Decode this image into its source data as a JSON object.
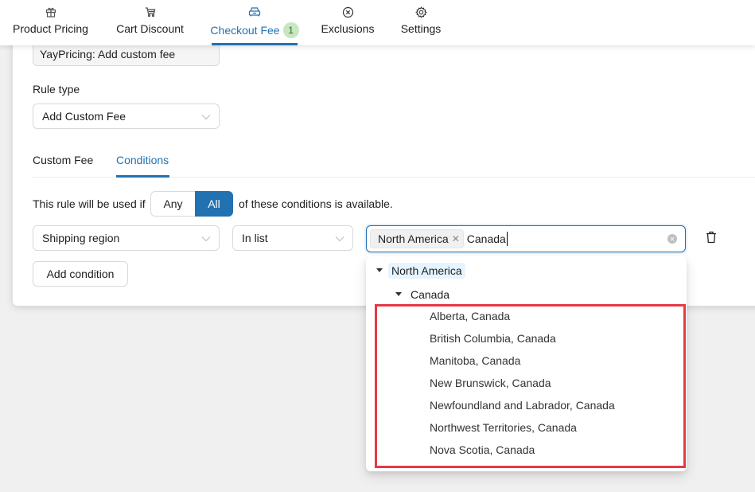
{
  "nav": {
    "tabs": [
      {
        "label": "Product Pricing",
        "icon": "gift-icon"
      },
      {
        "label": "Cart Discount",
        "icon": "cart-icon"
      },
      {
        "label": "Checkout Fee",
        "icon": "car-icon",
        "badge": "1",
        "active": true
      },
      {
        "label": "Exclusions",
        "icon": "circle-x-icon"
      },
      {
        "label": "Settings",
        "icon": "gear-icon"
      }
    ]
  },
  "rule": {
    "name_value": "YayPricing: Add custom fee",
    "rule_type_label": "Rule type",
    "rule_type_value": "Add Custom Fee"
  },
  "subtabs": [
    {
      "label": "Custom Fee"
    },
    {
      "label": "Conditions",
      "active": true
    }
  ],
  "conditions": {
    "prefix": "This rule will be used if",
    "any_label": "Any",
    "all_label": "All",
    "selected_match": "All",
    "suffix": "of these conditions is available.",
    "condition_field": "Shipping region",
    "operator": "In list",
    "selected_tags": [
      "North America"
    ],
    "search_text": "Canada",
    "add_condition_label": "Add condition"
  },
  "dropdown": {
    "root": "North America",
    "child": "Canada",
    "leaves": [
      "Alberta, Canada",
      "British Columbia, Canada",
      "Manitoba, Canada",
      "New Brunswick, Canada",
      "Newfoundland and Labrador, Canada",
      "Northwest Territories, Canada",
      "Nova Scotia, Canada"
    ]
  },
  "colors": {
    "accent": "#2271b1",
    "badge_bg": "#c8e6c0",
    "highlight": "#e63946"
  }
}
